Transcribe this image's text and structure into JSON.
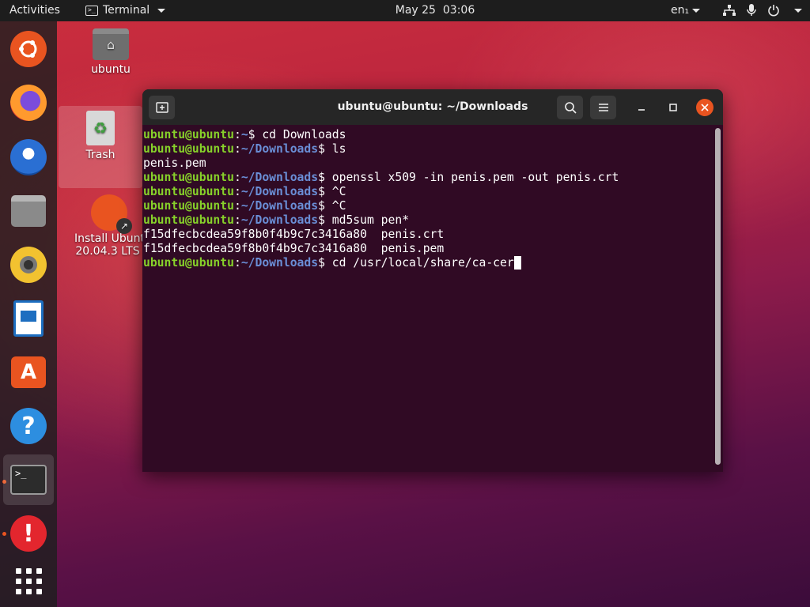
{
  "topbar": {
    "activities": "Activities",
    "app_name": "Terminal",
    "date": "May 25",
    "time": "03:06",
    "language": "en"
  },
  "dock": {
    "items": [
      {
        "name": "ubuntu-installer",
        "icon": "ubuntu-icon"
      },
      {
        "name": "firefox",
        "icon": "firefox-icon"
      },
      {
        "name": "thunderbird",
        "icon": "thunderbird-icon"
      },
      {
        "name": "files",
        "icon": "folder-icon"
      },
      {
        "name": "rhythmbox",
        "icon": "rhythmbox-icon"
      },
      {
        "name": "libreoffice-writer",
        "icon": "writer-icon"
      },
      {
        "name": "ubuntu-software",
        "icon": "software-store-icon"
      },
      {
        "name": "help",
        "icon": "help-icon"
      },
      {
        "name": "terminal",
        "icon": "terminal-icon",
        "active": true
      },
      {
        "name": "error-report",
        "icon": "error-icon"
      },
      {
        "name": "show-applications",
        "icon": "app-grid-icon"
      }
    ]
  },
  "desktop": {
    "home_label": "ubuntu",
    "trash_label": "Trash",
    "install_label_1": "Install Ubunt",
    "install_label_2": "20.04.3 LTS"
  },
  "terminal": {
    "title": "ubuntu@ubuntu: ~/Downloads",
    "user_host": "ubuntu@ubuntu",
    "lines": [
      {
        "type": "prompt",
        "path": "~",
        "cmd": "cd Downloads"
      },
      {
        "type": "prompt",
        "path": "~/Downloads",
        "cmd": "ls"
      },
      {
        "type": "output",
        "text": "penis.pem"
      },
      {
        "type": "prompt",
        "path": "~/Downloads",
        "cmd": "openssl x509 -in penis.pem -out penis.crt"
      },
      {
        "type": "prompt",
        "path": "~/Downloads",
        "cmd": "^C"
      },
      {
        "type": "prompt",
        "path": "~/Downloads",
        "cmd": "^C"
      },
      {
        "type": "prompt",
        "path": "~/Downloads",
        "cmd": "md5sum pen*"
      },
      {
        "type": "output",
        "text": "f15dfecbcdea59f8b0f4b9c7c3416a80  penis.crt"
      },
      {
        "type": "output",
        "text": "f15dfecbcdea59f8b0f4b9c7c3416a80  penis.pem"
      },
      {
        "type": "prompt",
        "path": "~/Downloads",
        "cmd": "cd /usr/local/share/ca-cer",
        "cursor": true
      }
    ]
  }
}
